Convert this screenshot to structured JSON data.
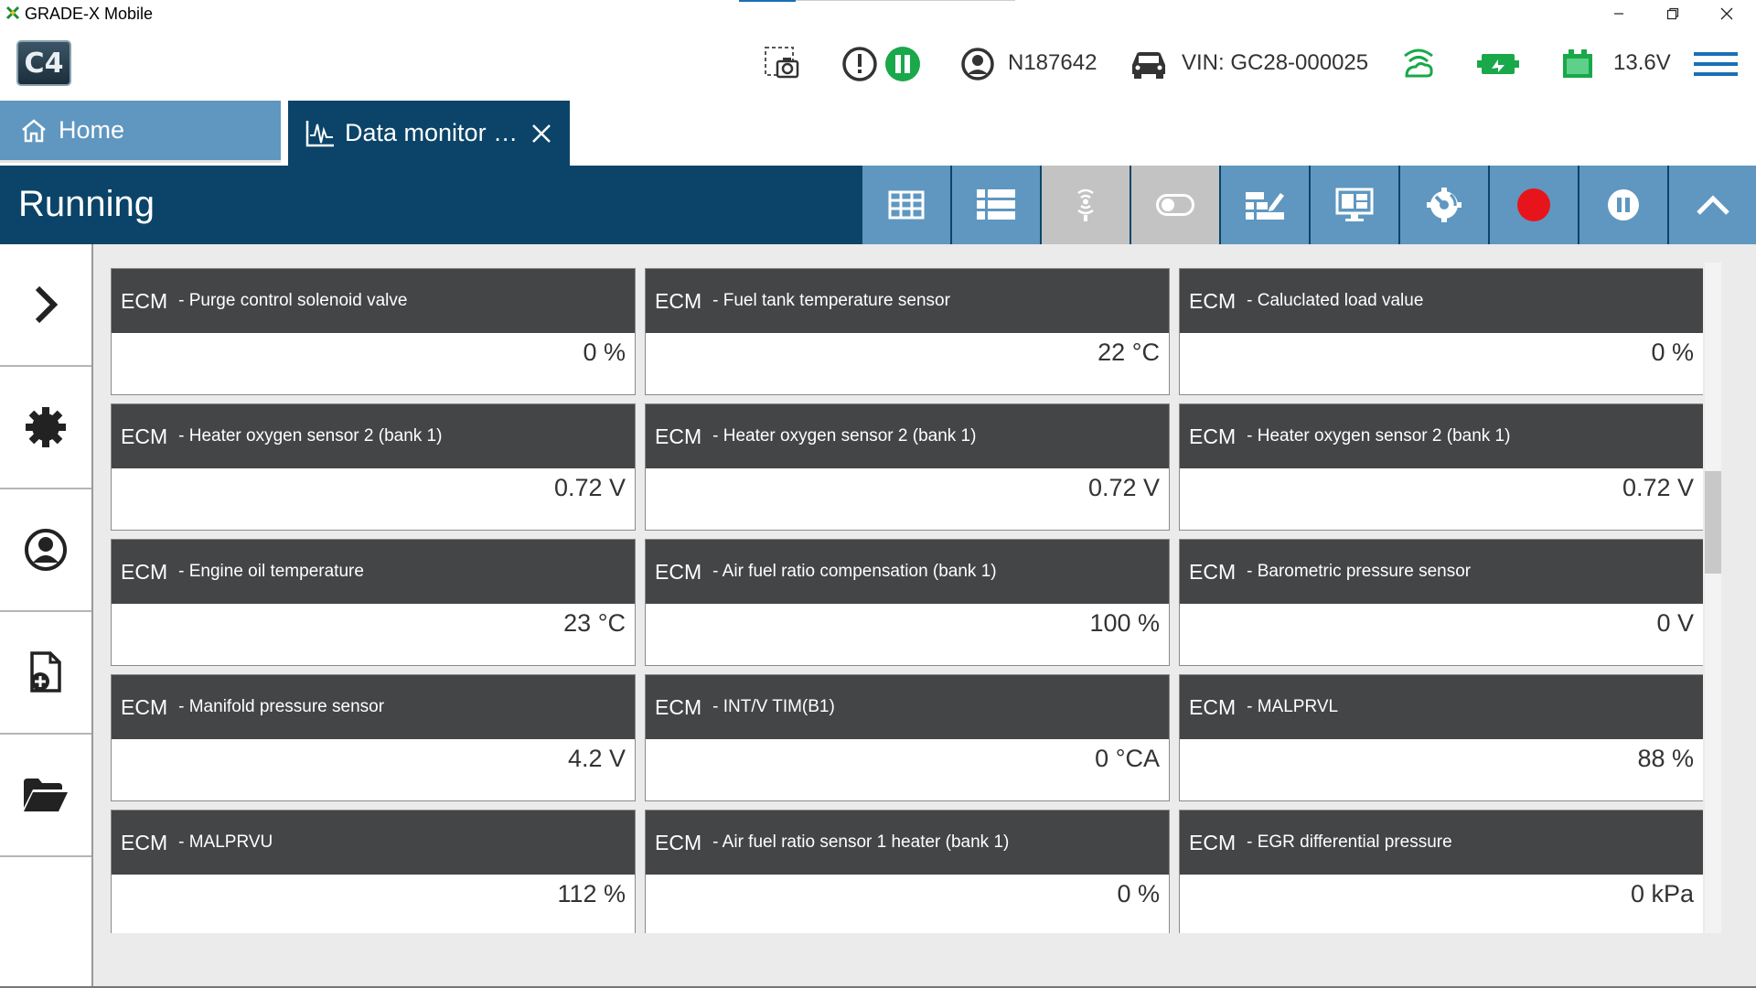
{
  "window": {
    "title": "GRADE-X Mobile",
    "minimize_icon": "minimize-icon",
    "maximize_icon": "restore-icon",
    "close_icon": "close-icon"
  },
  "header": {
    "logo_text": "C4",
    "user_id": "N187642",
    "vin": "VIN: GC28-000025",
    "battery_voltage": "13.6V",
    "status_green": "#19a84a"
  },
  "tabs": {
    "home_label": "Home",
    "data_monitor_label": "Data monitor …"
  },
  "toolbar": {
    "status_title": "Running",
    "accent": "#5f97c0",
    "dark": "#0b4468",
    "record_color": "#e8141b"
  },
  "sidebar": {
    "items": [
      "chevron-right-icon",
      "gear-icon",
      "user-icon",
      "new-file-icon",
      "folder-icon"
    ]
  },
  "cards": [
    {
      "ecu": "ECM",
      "name": "- Purge control solenoid valve",
      "value": "0 %"
    },
    {
      "ecu": "ECM",
      "name": "- Fuel tank temperature sensor",
      "value": "22 °C"
    },
    {
      "ecu": "ECM",
      "name": "- Caluclated load value",
      "value": "0 %"
    },
    {
      "ecu": "ECM",
      "name": "- Heater oxygen sensor 2 (bank 1)",
      "value": "0.72 V"
    },
    {
      "ecu": "ECM",
      "name": "- Heater oxygen sensor 2 (bank 1)",
      "value": "0.72 V"
    },
    {
      "ecu": "ECM",
      "name": "- Heater oxygen sensor 2 (bank 1)",
      "value": "0.72 V"
    },
    {
      "ecu": "ECM",
      "name": "- Engine oil temperature",
      "value": "23 °C"
    },
    {
      "ecu": "ECM",
      "name": "- Air fuel ratio compensation (bank 1)",
      "value": "100 %"
    },
    {
      "ecu": "ECM",
      "name": "- Barometric pressure sensor",
      "value": "0 V"
    },
    {
      "ecu": "ECM",
      "name": "- Manifold pressure sensor",
      "value": "4.2 V"
    },
    {
      "ecu": "ECM",
      "name": "- INT/V TIM(B1)",
      "value": "0 °CA"
    },
    {
      "ecu": "ECM",
      "name": "- MALPRVL",
      "value": "88 %"
    },
    {
      "ecu": "ECM",
      "name": "- MALPRVU",
      "value": "112 %"
    },
    {
      "ecu": "ECM",
      "name": "- Air fuel ratio sensor 1 heater (bank 1)",
      "value": "0 %"
    },
    {
      "ecu": "ECM",
      "name": "- EGR differential pressure",
      "value": "0 kPa"
    }
  ]
}
